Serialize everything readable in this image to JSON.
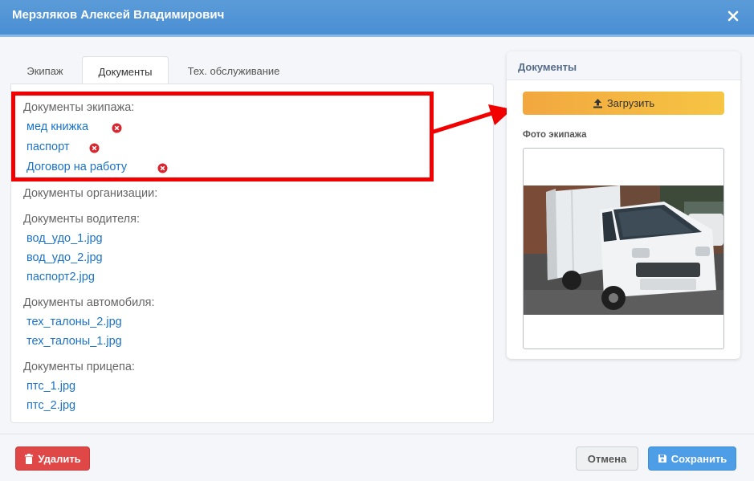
{
  "window": {
    "title": "Мерзляков Алексей Владимирович",
    "close_icon": "close-icon"
  },
  "tabs": [
    {
      "label": "Экипаж",
      "active": false
    },
    {
      "label": "Документы",
      "active": true
    },
    {
      "label": "Тех. обслуживание",
      "active": false
    }
  ],
  "sections": {
    "crew": {
      "label": "Документы экипажа:",
      "docs": [
        "мед книжка",
        "паспорт",
        "Договор на работу"
      ]
    },
    "organization": {
      "label": "Документы организации:"
    },
    "driver": {
      "label": "Документы водителя:",
      "docs": [
        "вод_удо_1.jpg",
        "вод_удо_2.jpg",
        "паспорт2.jpg"
      ]
    },
    "vehicle": {
      "label": "Документы автомобиля:",
      "docs": [
        "тех_талоны_2.jpg",
        "тех_талоны_1.jpg"
      ]
    },
    "trailer": {
      "label": "Документы прицепа:",
      "docs": [
        "птс_1.jpg",
        "птс_2.jpg"
      ]
    }
  },
  "side_panel": {
    "title": "Документы",
    "upload_label": "Загрузить",
    "photo_label": "Фото экипажа"
  },
  "footer": {
    "delete_label": "Удалить",
    "cancel_label": "Отмена",
    "save_label": "Сохранить"
  },
  "colors": {
    "header": "#4a8fd4",
    "link": "#1a73c8",
    "highlight": "#f20000",
    "upload": "#f4b340",
    "delete": "#e04848",
    "save": "#4d9ee6"
  }
}
